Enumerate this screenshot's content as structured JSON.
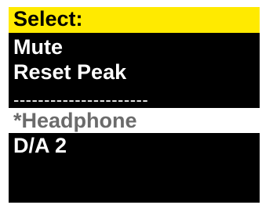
{
  "menu": {
    "title": "Select:",
    "items": [
      {
        "label": "Mute"
      },
      {
        "label": "Reset Peak"
      },
      {
        "label": "----------------------"
      },
      {
        "label": "*Headphone",
        "selected": true
      },
      {
        "label": "D/A 2"
      }
    ]
  },
  "colors": {
    "title_bg": "#ffea00",
    "panel_bg": "#000000",
    "item_text": "#ffffff",
    "selected_bg": "#ffffff",
    "selected_text": "#6b6b6b"
  }
}
